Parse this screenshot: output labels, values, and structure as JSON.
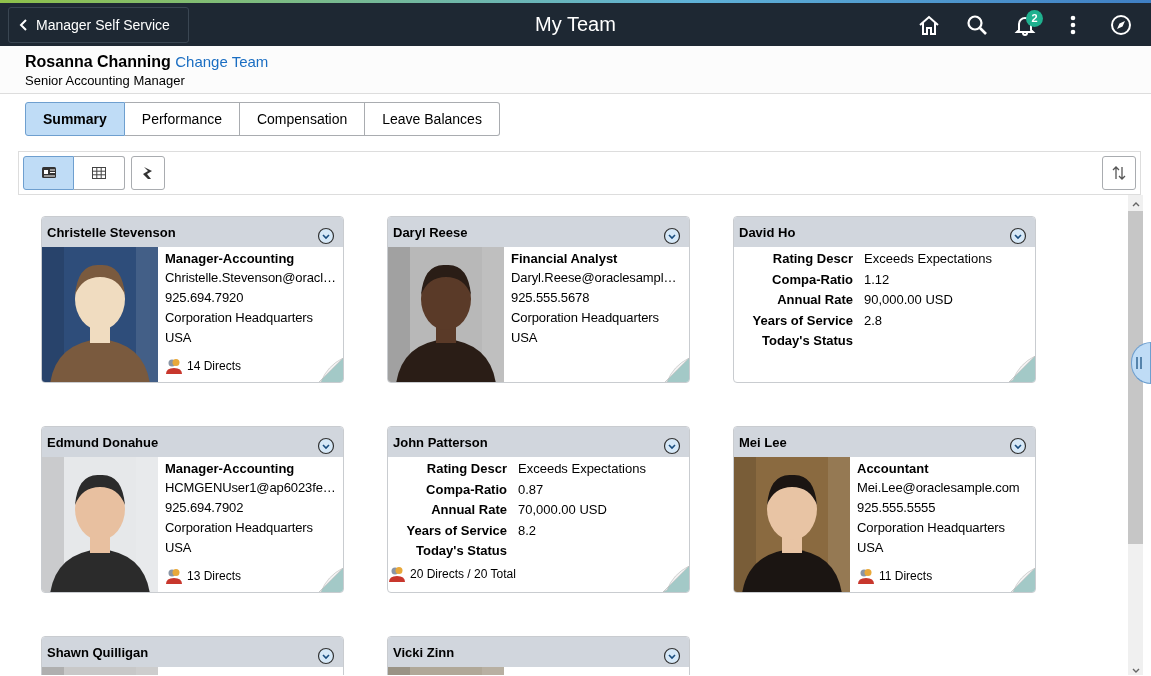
{
  "header": {
    "back_label": "Manager Self Service",
    "title": "My Team",
    "notification_count": "2"
  },
  "manager": {
    "name": "Rosanna Channing",
    "link": "Change Team",
    "job_title": "Senior Accounting Manager"
  },
  "tabs": [
    {
      "label": "Summary",
      "selected": true
    },
    {
      "label": "Performance",
      "selected": false
    },
    {
      "label": "Compensation",
      "selected": false
    },
    {
      "label": "Leave Balances",
      "selected": false
    }
  ],
  "view_buttons": [
    {
      "kind": "cards",
      "selected": true
    },
    {
      "kind": "grid",
      "selected": false
    }
  ],
  "cards": [
    {
      "name": "Christelle Stevenson",
      "kind": "contact",
      "photo": {
        "kind": "picture"
      },
      "title": "Manager-Accounting",
      "lines": [
        "Christelle.Stevenson@oracl…",
        "925.694.7920",
        "Corporation Headquarters",
        "USA"
      ],
      "directs": "14 Directs"
    },
    {
      "name": "Daryl Reese",
      "kind": "contact",
      "photo": {
        "kind": "picture"
      },
      "title": "Financial Analyst",
      "lines": [
        "Daryl.Reese@oraclesampl…",
        "925.555.5678",
        "Corporation Headquarters",
        "USA"
      ]
    },
    {
      "name": "David Ho",
      "kind": "metrics",
      "fields": [
        {
          "label": "Rating Descr",
          "value": "Exceeds Expectations"
        },
        {
          "label": "Compa-Ratio",
          "value": "1.12"
        },
        {
          "label": "Annual Rate",
          "value": "90,000.00 USD"
        },
        {
          "label": "Years of Service",
          "value": "2.8"
        },
        {
          "label": "Today's Status"
        }
      ]
    },
    {
      "name": "Edmund Donahue",
      "kind": "contact",
      "photo": {
        "kind": "picture"
      },
      "title": "Manager-Accounting",
      "lines": [
        "HCMGENUser1@ap6023fe…",
        "925.694.7902",
        "Corporation Headquarters",
        "USA"
      ],
      "directs": "13 Directs"
    },
    {
      "name": "John Patterson",
      "kind": "metrics",
      "fields": [
        {
          "label": "Rating Descr",
          "value": "Exceeds Expectations"
        },
        {
          "label": "Compa-Ratio",
          "value": "0.87"
        },
        {
          "label": "Annual Rate",
          "value": "70,000.00 USD"
        },
        {
          "label": "Years of Service",
          "value": "8.2"
        },
        {
          "label": "Today's Status"
        }
      ],
      "directs": "20 Directs / 20 Total"
    },
    {
      "name": "Mei Lee",
      "kind": "contact",
      "photo": {
        "kind": "picture"
      },
      "title": "Accountant",
      "lines": [
        "Mei.Lee@oraclesample.com",
        "925.555.5555",
        "Corporation Headquarters",
        "USA"
      ],
      "directs": "11 Directs"
    },
    {
      "name": "Shawn Quilligan",
      "kind": "contact",
      "photo": {
        "kind": "picture"
      }
    },
    {
      "name": "Vicki Zinn",
      "kind": "contact",
      "photo": {
        "kind": "picture"
      }
    }
  ]
}
